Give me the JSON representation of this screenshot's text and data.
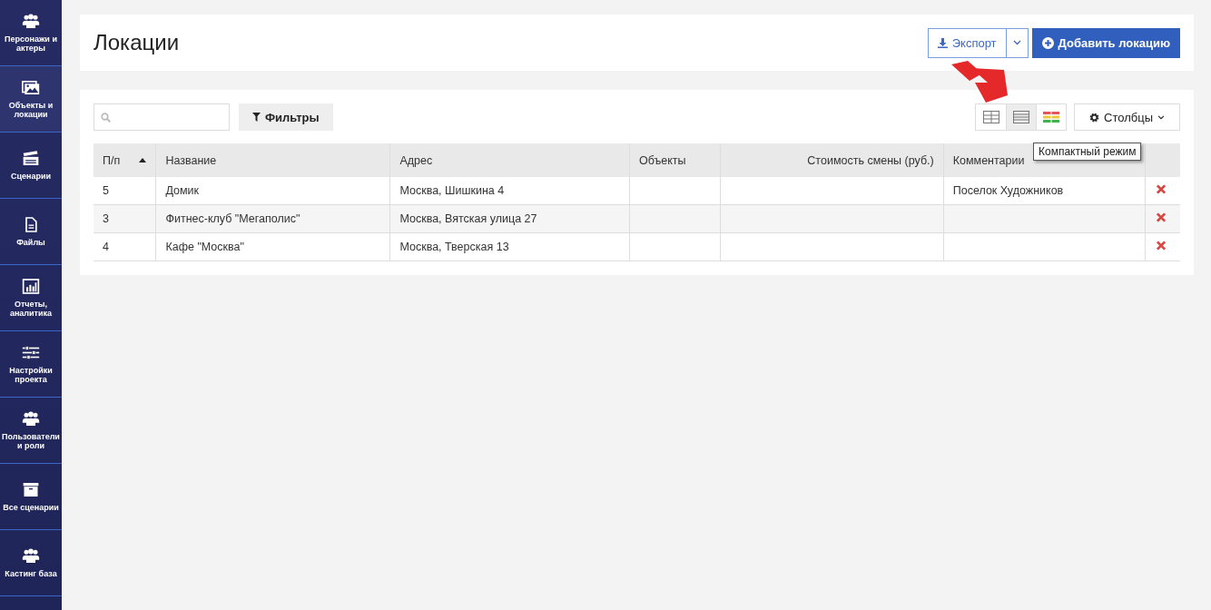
{
  "sidebar": {
    "items": [
      {
        "label": "Персонажи и актеры",
        "selected": false
      },
      {
        "label": "Объекты и локации",
        "selected": true
      },
      {
        "label": "Сценарии",
        "selected": false
      },
      {
        "label": "Файлы",
        "selected": false
      },
      {
        "label": "Отчеты, аналитика",
        "selected": false
      },
      {
        "label": "Настройки проекта",
        "selected": false
      },
      {
        "label": "Пользователи и роли",
        "selected": false
      },
      {
        "label": "Все сценарии",
        "selected": false
      },
      {
        "label": "Кастинг база",
        "selected": false
      }
    ]
  },
  "header": {
    "title": "Локации",
    "export_button": "Экспорт",
    "add_button": "Добавить локацию"
  },
  "toolbar": {
    "filters_button": "Фильтры",
    "view_modes": [
      {
        "kind": "grid",
        "selected": false
      },
      {
        "kind": "list",
        "selected": true
      },
      {
        "kind": "color",
        "selected": false
      }
    ],
    "columns_button": "Столбцы",
    "tooltip": "Компактный режим"
  },
  "table": {
    "columns": [
      {
        "label": "П/п",
        "sorted": true
      },
      {
        "label": "Название",
        "sorted": false
      },
      {
        "label": "Адрес",
        "sorted": false
      },
      {
        "label": "Объекты",
        "sorted": false
      },
      {
        "label": "Стоимость смены (руб.)",
        "sorted": false
      },
      {
        "label": "Комментарии",
        "sorted": false
      }
    ],
    "rows": [
      {
        "cells": [
          "5",
          "Домик",
          "Москва, Шишкина 4",
          "",
          "",
          "Поселок Художников"
        ]
      },
      {
        "cells": [
          "3",
          "Фитнес-клуб \"Мегаполис\"",
          "Москва, Вятская улица 27",
          "",
          "",
          ""
        ]
      },
      {
        "cells": [
          "4",
          "Кафе \"Москва\"",
          "Москва, Тверская 13",
          "",
          "",
          ""
        ]
      }
    ]
  }
}
